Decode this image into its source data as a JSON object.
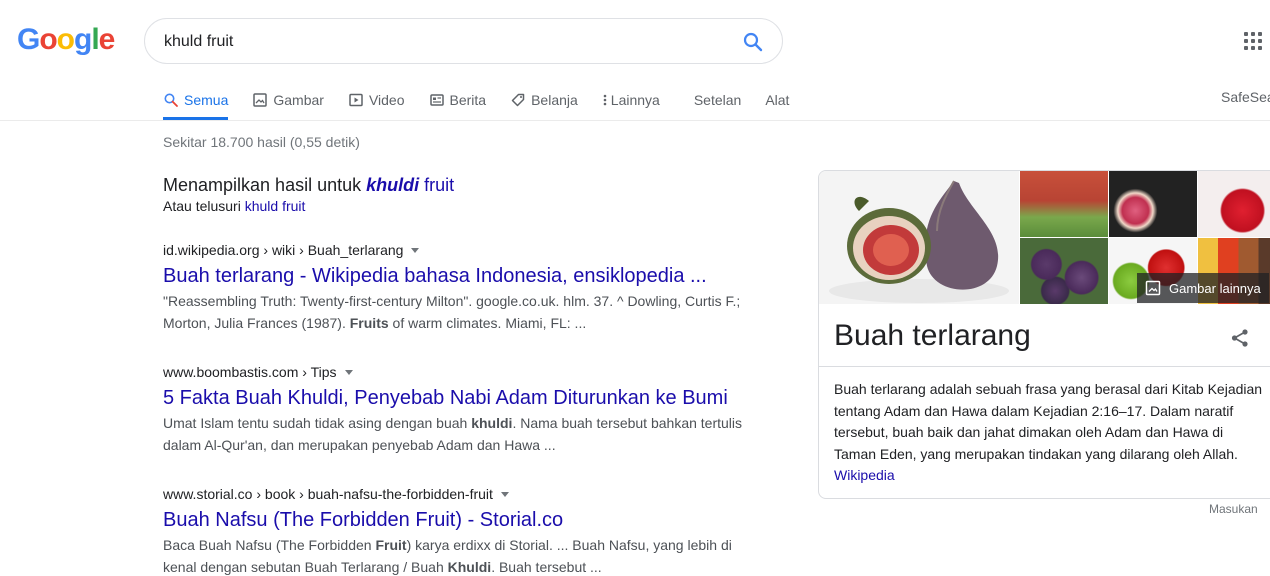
{
  "logo": {
    "letters": [
      "G",
      "o",
      "o",
      "g",
      "l",
      "e"
    ],
    "colors": [
      "#4285F4",
      "#EA4335",
      "#FBBC05",
      "#4285F4",
      "#34A853",
      "#EA4335"
    ]
  },
  "search": {
    "query": "khuld fruit"
  },
  "tabs": [
    {
      "label": "Semua",
      "icon": "search-icon",
      "active": true
    },
    {
      "label": "Gambar",
      "icon": "image-icon"
    },
    {
      "label": "Video",
      "icon": "video-icon"
    },
    {
      "label": "Berita",
      "icon": "news-icon"
    },
    {
      "label": "Belanja",
      "icon": "tag-icon"
    },
    {
      "label": "Lainnya",
      "icon": "more-vert-icon"
    }
  ],
  "tools": {
    "settings": "Setelan",
    "tools": "Alat"
  },
  "safesearch": "SafeSea",
  "stats": "Sekitar 18.700 hasil (0,55 detik)",
  "spell": {
    "showing": "Menampilkan hasil untuk ",
    "corrected_bold": "khuldi",
    "corrected_rest": " fruit",
    "instead": "Atau telusuri ",
    "original": "khuld fruit"
  },
  "results": [
    {
      "cite": "id.wikipedia.org › wiki › Buah_terlarang",
      "title": "Buah terlarang - Wikipedia bahasa Indonesia, ensiklopedia ...",
      "snippet_parts": [
        {
          "t": "\"Reassembling Truth: Twenty-first-century Milton\". google.co.uk. hlm. 37. ^ Dowling, Curtis F.; Morton, Julia Frances (1987). "
        },
        {
          "t": "Fruits",
          "b": true
        },
        {
          "t": " of warm climates. Miami, FL: ..."
        }
      ]
    },
    {
      "cite": "www.boombastis.com › Tips",
      "title": "5 Fakta Buah Khuldi, Penyebab Nabi Adam Diturunkan ke Bumi",
      "snippet_parts": [
        {
          "t": "Umat Islam tentu sudah tidak asing dengan buah "
        },
        {
          "t": "khuldi",
          "b": true
        },
        {
          "t": ". Nama buah tersebut bahkan tertulis dalam Al-Qur'an, dan merupakan penyebab Adam dan Hawa ..."
        }
      ]
    },
    {
      "cite": "www.storial.co › book › buah-nafsu-the-forbidden-fruit",
      "title": "Buah Nafsu (The Forbidden Fruit) - Storial.co",
      "snippet_parts": [
        {
          "t": "Baca Buah Nafsu (The Forbidden "
        },
        {
          "t": "Fruit",
          "b": true
        },
        {
          "t": ") karya erdixx di Storial. ... Buah Nafsu, yang lebih di kenal dengan sebutan Buah Terlarang / Buah "
        },
        {
          "t": "Khuldi",
          "b": true
        },
        {
          "t": ". Buah tersebut ..."
        }
      ]
    }
  ],
  "knowledge_panel": {
    "title": "Buah terlarang",
    "more_images": "Gambar lainnya",
    "description": "Buah terlarang adalah sebuah frasa yang berasal dari Kitab Kejadian tentang Adam dan Hawa dalam Kejadian 2:16–17. Dalam naratif tersebut, buah baik dan jahat dimakan oleh Adam dan Hawa di Taman Eden, yang merupakan tindakan yang dilarang oleh Allah.",
    "source": "Wikipedia",
    "share_icon": "share-icon"
  },
  "feedback": "Masukan"
}
